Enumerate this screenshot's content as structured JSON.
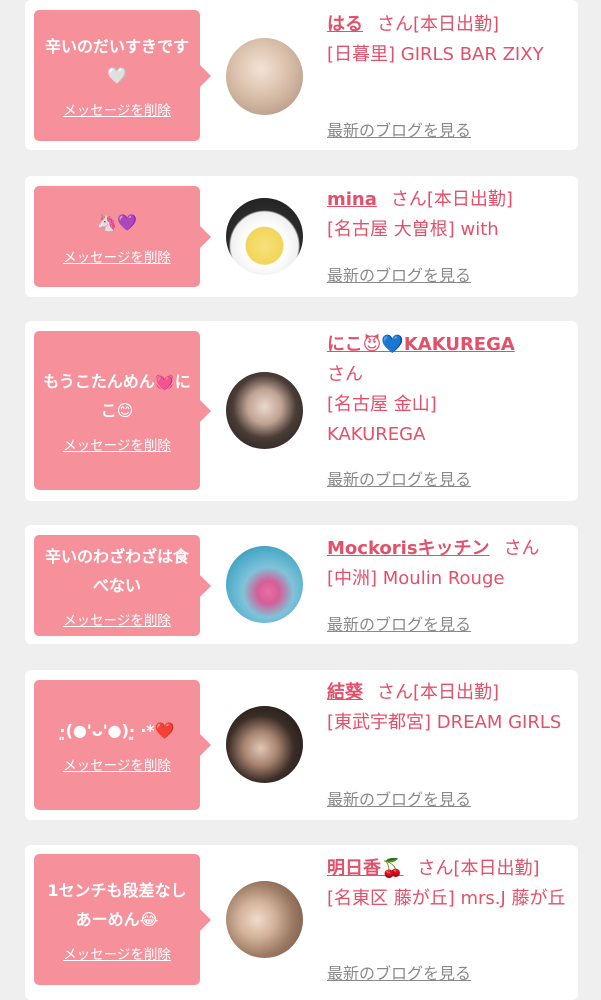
{
  "common": {
    "delete_label": "メッセージを削除",
    "blog_label": "最新のブログを見る"
  },
  "colors": {
    "bubble": "#f6919c",
    "accent": "#e3506a",
    "muted": "#8a8a8a",
    "background": "#efefef"
  },
  "cards": [
    {
      "message": "辛いのだいすきです🤍",
      "name": "はる",
      "suffix": "さん[本日出勤]",
      "shop": "[日暮里] GIRLS BAR ZIXY"
    },
    {
      "message": "🦄💜",
      "name": "mina",
      "suffix": "さん[本日出勤]",
      "shop": "[名古屋 大曽根] with"
    },
    {
      "message": "もうこたんめん💓にこ😊",
      "name": "にこ😈💙KAKUREGA",
      "suffix": "さん",
      "shop": "[名古屋 金山] KAKUREGA"
    },
    {
      "message": "辛いのわざわざは食べない",
      "name": "Mockorisキッチン",
      "suffix": "さん",
      "shop": "[中洲] Moulin Rouge"
    },
    {
      "message": "·͈(●'ᴗ'●)·͈ ‧*❤️",
      "name": "結葵",
      "suffix": "さん[本日出勤]",
      "shop": "[東武宇都宮] DREAM GIRLS"
    },
    {
      "message": "1センチも段差なしあーめん😂",
      "name": "明日香🍒",
      "suffix": "さん[本日出勤]",
      "shop": "[名東区 藤が丘] mrs.J 藤が丘"
    }
  ]
}
